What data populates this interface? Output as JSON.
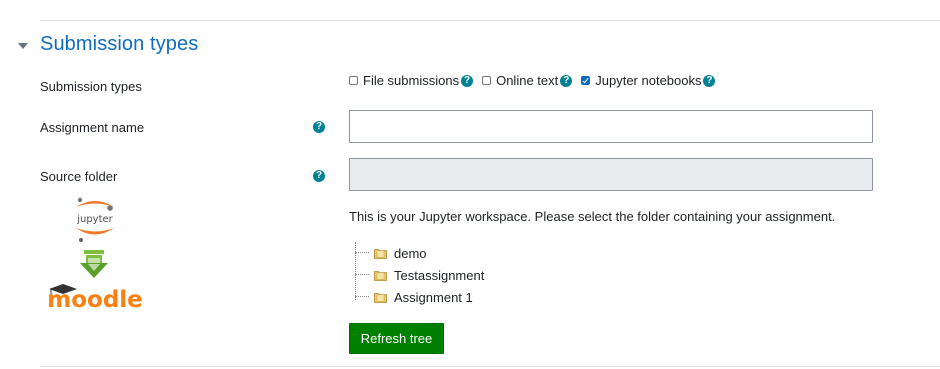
{
  "section": {
    "title": "Submission types"
  },
  "fields": {
    "submission_types_label": "Submission types",
    "options": [
      {
        "label": "File submissions",
        "checked": false
      },
      {
        "label": "Online text",
        "checked": false
      },
      {
        "label": "Jupyter notebooks",
        "checked": true
      }
    ],
    "assignment_name_label": "Assignment name",
    "assignment_name_value": "",
    "source_folder_label": "Source folder",
    "source_folder_value": ""
  },
  "help_glyph": "?",
  "logo": {
    "top_text": "jupyter",
    "bottom_text": "moodle"
  },
  "workspace": {
    "instruction": "This is your Jupyter workspace. Please select the folder containing your assignment.",
    "tree": [
      {
        "label": "demo"
      },
      {
        "label": "Testassignment"
      },
      {
        "label": "Assignment 1"
      }
    ],
    "refresh_label": "Refresh tree"
  },
  "colors": {
    "title": "#0f6cbf",
    "help_icon": "#008196",
    "button": "#008000",
    "folder": "#e8c76a"
  }
}
